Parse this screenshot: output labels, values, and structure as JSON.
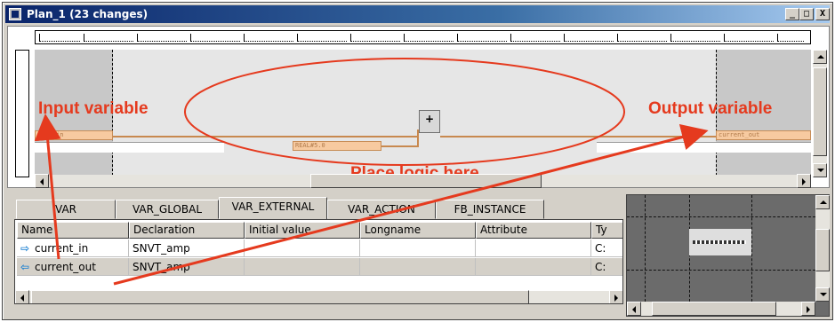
{
  "window": {
    "title": "Plan_1 (23 changes)",
    "min_label": "_",
    "max_label": "□",
    "close_label": "X"
  },
  "diagram": {
    "annotations": {
      "input_label": "Input variable",
      "output_label": "Output variable",
      "center_label": "Place logic here"
    },
    "input_box": "cent_in",
    "output_box": "current_out",
    "constant_box": "REAL#5.0",
    "fb_label": "+"
  },
  "tabs": [
    {
      "label": "VAR",
      "active": false
    },
    {
      "label": "VAR_GLOBAL",
      "active": false
    },
    {
      "label": "VAR_EXTERNAL",
      "active": true
    },
    {
      "label": "VAR_ACTION",
      "active": false
    },
    {
      "label": "FB_INSTANCE",
      "active": false
    }
  ],
  "table": {
    "columns": [
      "Name",
      "Declaration",
      "Initial value",
      "Longname",
      "Attribute",
      "Ty"
    ],
    "rows": [
      {
        "icon": "input-arrow-icon",
        "name": "current_in",
        "declaration": "SNVT_amp",
        "initial": "",
        "longname": "",
        "attribute": "",
        "type": "C:"
      },
      {
        "icon": "output-arrow-icon",
        "name": "current_out",
        "declaration": "SNVT_amp",
        "initial": "",
        "longname": "",
        "attribute": "",
        "type": "C:"
      }
    ]
  },
  "colors": {
    "annotation_red": "#e53a1e",
    "variable_orange": "#f7caa0",
    "signal_line": "#c8894f",
    "title_start": "#0a246a"
  }
}
